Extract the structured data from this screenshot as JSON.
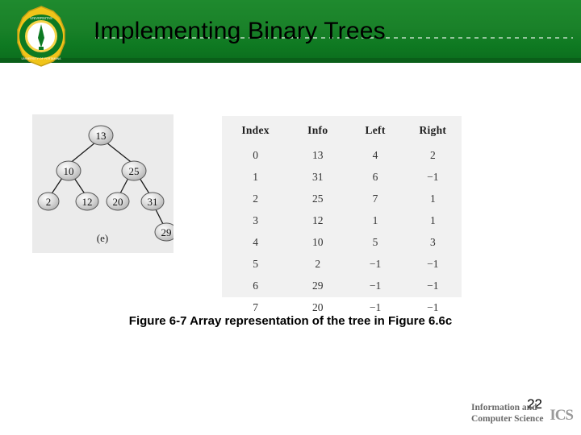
{
  "slide": {
    "title": "Implementing Binary Trees",
    "caption": "Figure 6-7 Array representation of the tree in Figure 6.6c",
    "page_number": "22"
  },
  "logo": {
    "name": "university-seal",
    "top_text": "UNIVERSITAS",
    "bottom_text": "UNIVERSITY OF PERTAMINA"
  },
  "tree_figure": {
    "label": "(e)",
    "nodes": [
      {
        "value": "13"
      },
      {
        "value": "10"
      },
      {
        "value": "25"
      },
      {
        "value": "2"
      },
      {
        "value": "12"
      },
      {
        "value": "20"
      },
      {
        "value": "31"
      },
      {
        "value": "29"
      }
    ]
  },
  "array_table": {
    "headers": [
      "Index",
      "Info",
      "Left",
      "Right"
    ],
    "rows": [
      [
        "0",
        "13",
        "4",
        "2"
      ],
      [
        "1",
        "31",
        "6",
        "−1"
      ],
      [
        "2",
        "25",
        "7",
        "1"
      ],
      [
        "3",
        "12",
        "1",
        "1"
      ],
      [
        "4",
        "10",
        "5",
        "3"
      ],
      [
        "5",
        "2",
        "−1",
        "−1"
      ],
      [
        "6",
        "29",
        "−1",
        "−1"
      ],
      [
        "7",
        "20",
        "−1",
        "−1"
      ]
    ]
  },
  "footer_logo": {
    "line1": "Information and",
    "line2": "Computer Science",
    "mark": "ICS"
  },
  "colors": {
    "header_green": "#1a8129",
    "header_green_dark": "#0b6d1d",
    "figure_bg": "#ebebeb",
    "table_bg": "#f1f1f1"
  }
}
